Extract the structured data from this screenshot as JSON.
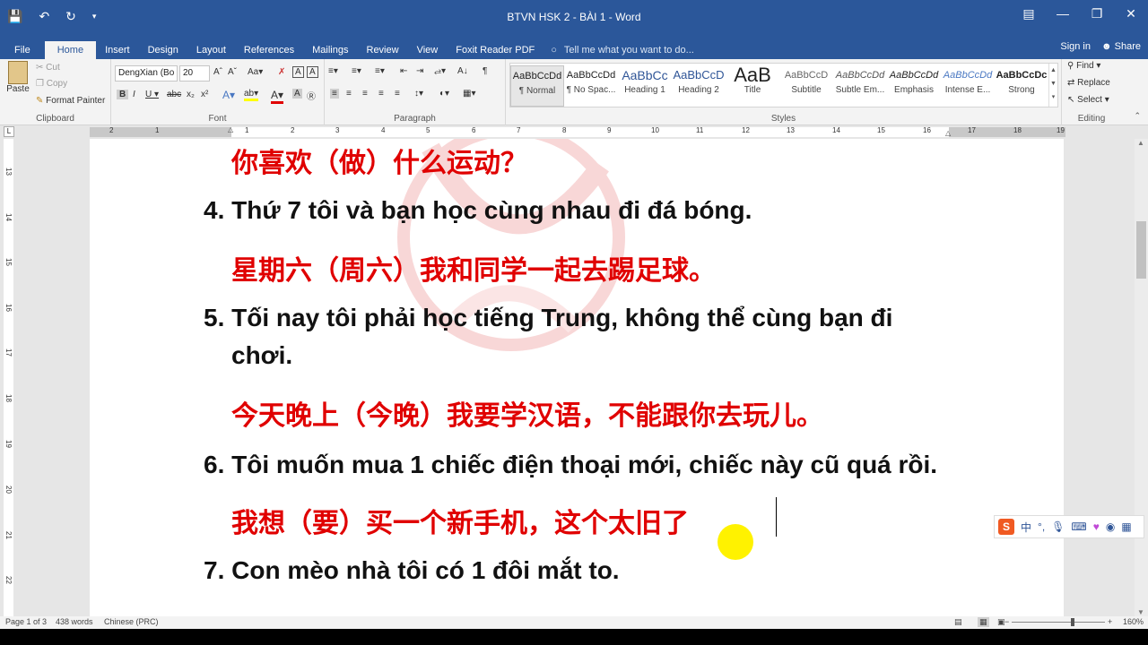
{
  "window": {
    "title": "BTVN HSK 2 - BÀI 1 - Word"
  },
  "qat": {
    "save_icon": "save-icon",
    "undo_icon": "undo-icon",
    "redo_icon": "redo-icon",
    "customize_icon": "customize-icon"
  },
  "tabs": {
    "items": [
      "File",
      "Home",
      "Insert",
      "Design",
      "Layout",
      "References",
      "Mailings",
      "Review",
      "View",
      "Foxit Reader PDF"
    ],
    "active": "Home",
    "tell_me": "Tell me what you want to do...",
    "sign_in": "Sign in",
    "share": "Share"
  },
  "clipboard": {
    "paste": "Paste",
    "cut": "Cut",
    "copy": "Copy",
    "format_painter": "Format Painter",
    "label": "Clipboard"
  },
  "font": {
    "name": "DengXian (Bo",
    "size": "20",
    "label": "Font"
  },
  "paragraph": {
    "label": "Paragraph"
  },
  "styles": {
    "label": "Styles",
    "items": [
      {
        "preview": "AaBbCcDd",
        "name": "¶ Normal"
      },
      {
        "preview": "AaBbCcDd",
        "name": "¶ No Spac..."
      },
      {
        "preview": "AaBbCc",
        "name": "Heading 1"
      },
      {
        "preview": "AaBbCcD",
        "name": "Heading 2"
      },
      {
        "preview": "AaB",
        "name": "Title"
      },
      {
        "preview": "AaBbCcD",
        "name": "Subtitle"
      },
      {
        "preview": "AaBbCcDd",
        "name": "Subtle Em..."
      },
      {
        "preview": "AaBbCcDd",
        "name": "Emphasis"
      },
      {
        "preview": "AaBbCcDd",
        "name": "Intense E..."
      },
      {
        "preview": "AaBbCcDc",
        "name": "Strong"
      }
    ]
  },
  "editing": {
    "find": "Find",
    "replace": "Replace",
    "select": "Select",
    "label": "Editing"
  },
  "ruler": {
    "numbers": [
      "2",
      "1",
      "1",
      "2",
      "3",
      "4",
      "5",
      "6",
      "7",
      "8",
      "9",
      "10",
      "11",
      "12",
      "13",
      "14",
      "15",
      "16",
      "17",
      "18",
      "19"
    ],
    "vnumbers": [
      "13",
      "14",
      "15",
      "16",
      "17",
      "18",
      "19",
      "20",
      "21",
      "22"
    ]
  },
  "document": {
    "lines": [
      {
        "kind": "cn",
        "text": "你喜欢（做）什么运动？"
      },
      {
        "kind": "vn",
        "text": "4. Thứ 7 tôi và bạn học cùng nhau đi đá bóng."
      },
      {
        "kind": "cn",
        "text": "星期六（周六）我和同学一起去踢足球。"
      },
      {
        "kind": "vn",
        "text": "5. Tối nay tôi phải học tiếng Trung, không thể cùng bạn đi"
      },
      {
        "kind": "vn",
        "text": "chơi."
      },
      {
        "kind": "cn",
        "text": "今天晚上（今晚）我要学汉语，不能跟你去玩儿。"
      },
      {
        "kind": "vn",
        "text": "6. Tôi muốn mua 1 chiếc điện thoại mới, chiếc này cũ quá rồi."
      },
      {
        "kind": "cn",
        "text": "我想（要）买一个新手机，这个太旧了"
      },
      {
        "kind": "vn",
        "text": "7. Con mèo nhà tôi có 1 đôi mắt to."
      }
    ]
  },
  "ime": {
    "logo": "S",
    "mode": "中"
  },
  "status": {
    "page": "Page 1 of 3",
    "words": "438 words",
    "language": "Chinese (PRC)",
    "zoom": "160%"
  }
}
